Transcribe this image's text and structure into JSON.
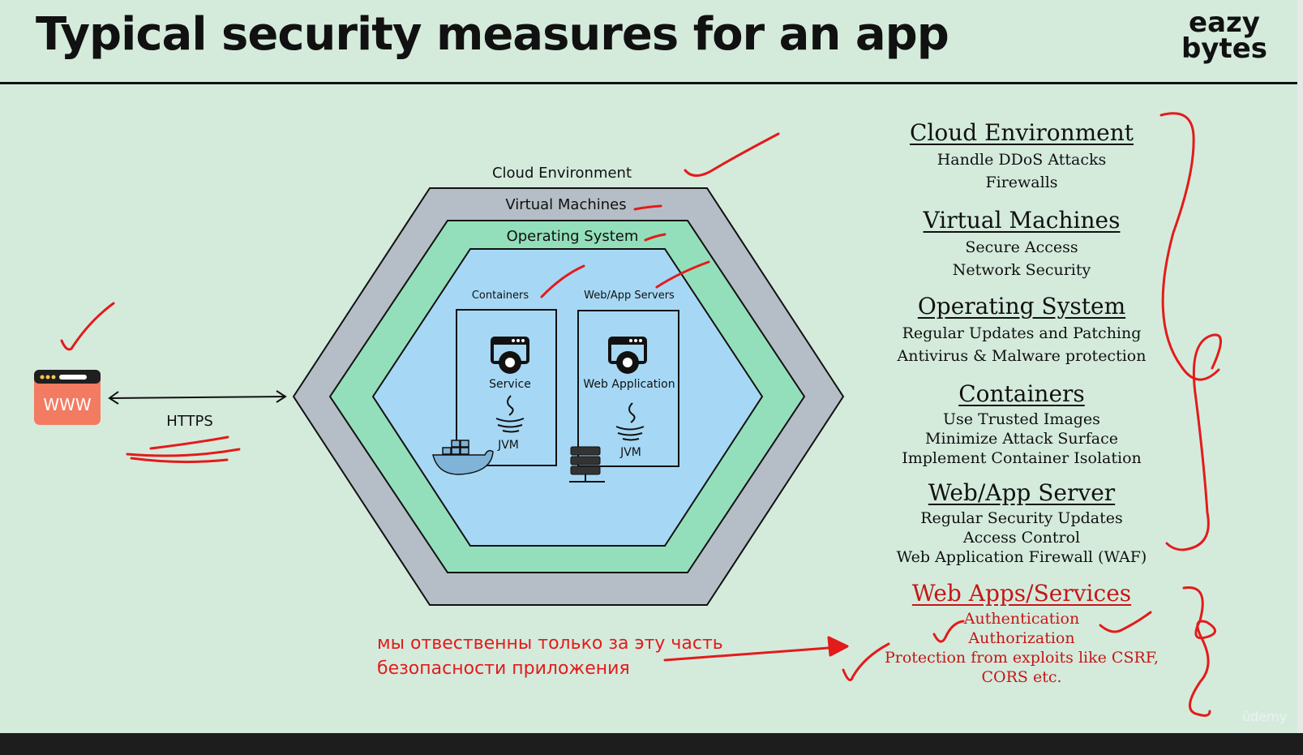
{
  "slide": {
    "title": "Typical security measures for an app",
    "logo_line1": "eazy",
    "logo_line2": "bytes"
  },
  "diagram": {
    "layer_cloud": "Cloud Environment",
    "layer_vm": "Virtual Machines",
    "layer_os": "Operating System",
    "containers_label": "Containers",
    "webapp_servers_label": "Web/App Servers",
    "service_label": "Service",
    "jvm_label_1": "JVM",
    "web_application_label": "Web Application",
    "jvm_label_2": "JVM",
    "www_label": "WWW",
    "https_label": "HTTPS"
  },
  "measures": [
    {
      "title": "Cloud Environment",
      "items": [
        "Handle DDoS Attacks",
        "Firewalls"
      ]
    },
    {
      "title": "Virtual Machines",
      "items": [
        "Secure Access",
        "Network Security"
      ]
    },
    {
      "title": "Operating System",
      "items": [
        "Regular Updates and Patching",
        "Antivirus & Malware protection"
      ]
    },
    {
      "title": "Containers",
      "items": [
        "Use Trusted Images",
        "Minimize Attack Surface",
        "Implement Container Isolation"
      ]
    },
    {
      "title": "Web/App Server",
      "items": [
        "Regular Security Updates",
        "Access Control",
        "Web Application Firewall (WAF)"
      ]
    },
    {
      "title": "Web Apps/Services",
      "items": [
        "Authentication",
        "Authorization",
        "Protection from exploits like CSRF,",
        "CORS etc."
      ]
    }
  ],
  "annotation": {
    "note_line1": "мы отвественны только за эту часть",
    "note_line2": "безопасности приложения"
  },
  "watermark": "ûdemy",
  "colors": {
    "background": "#d4ebdc",
    "vm_layer": "#b5bec6",
    "os_layer": "#94dfbb",
    "app_layer": "#a6d8f5",
    "annotation_red": "#e31b1b",
    "www_badge": "#f37b62"
  }
}
